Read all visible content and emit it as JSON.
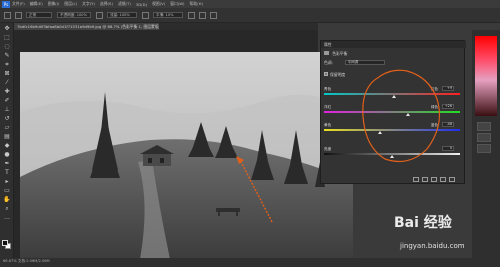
{
  "menubar": {
    "logo": "Ps",
    "items": [
      "文件(F)",
      "编辑(E)",
      "图像(I)",
      "图层(L)",
      "文字(Y)",
      "选择(S)",
      "滤镜(T)",
      "3D(D)",
      "视图(V)",
      "窗口(W)",
      "帮助(H)"
    ]
  },
  "options": {
    "mode_label": "正常",
    "opacity_label": "不透明度: 100%",
    "flow_label": "流量: 100%",
    "smoothing_label": "平滑: 10%"
  },
  "document": {
    "tab_title": "7bdfc16b9d0f3bfaa8b0d1f71531a9d9b9.jpg @ 66.7% (色彩平衡 1, 图层蒙版/8) *"
  },
  "properties": {
    "title": "属性",
    "adjustment_name": "色彩平衡",
    "tone_label": "色调:",
    "tone_value": "中间调",
    "sliders": [
      {
        "left": "青色",
        "right": "红色",
        "value": 0,
        "color": "#e8e8e8"
      },
      {
        "left": "洋红",
        "right": "绿色",
        "value": 0,
        "color": "#e8e8e8"
      },
      {
        "left": "黄色",
        "right": "蓝色",
        "value": 0,
        "color": "#e8e8e8"
      },
      {
        "left": "亮度",
        "right": "",
        "value": 0,
        "color": "#e8e8e8"
      }
    ],
    "value_texts": [
      "+9",
      "+26",
      "-48",
      "0"
    ],
    "preserve_label": "保留明度"
  },
  "status": {
    "text": "66.67%   文档:2.06M/2.06M"
  },
  "watermark": {
    "brand": "Bai 经验",
    "url": "jingyan.baidu.com"
  }
}
